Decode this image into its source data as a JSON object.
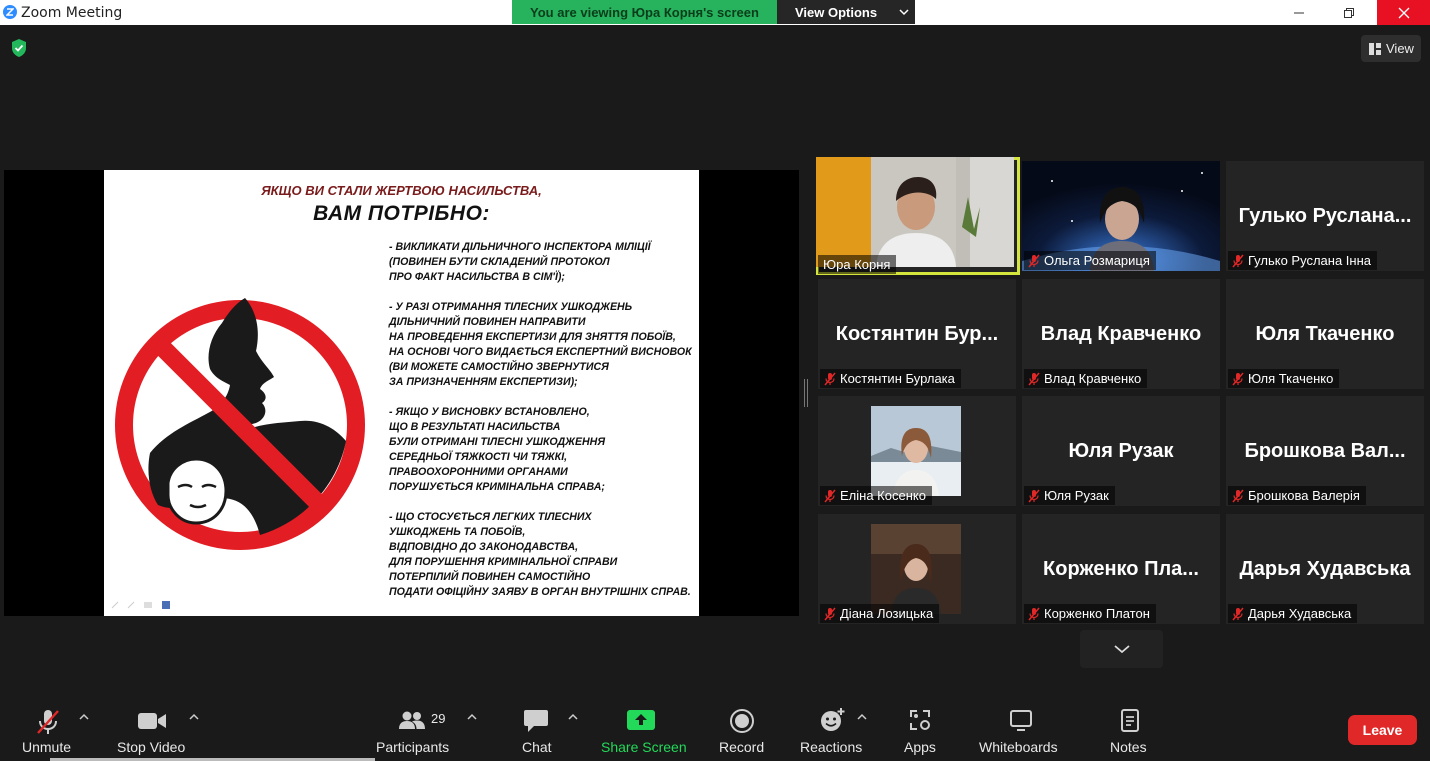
{
  "window": {
    "title": "Zoom Meeting"
  },
  "banner": {
    "viewing_text": "You are viewing Юра Корня's screen",
    "view_options": "View Options"
  },
  "top_right": {
    "view_label": "View"
  },
  "slide": {
    "title_line1": "ЯКЩО ВИ СТАЛИ ЖЕРТВОЮ НАСИЛЬСТВА,",
    "title_line2": "ВАМ ПОТРІБНО:",
    "paragraphs": [
      [
        "- ВИКЛИКАТИ ДІЛЬНИЧНОГО ІНСПЕКТОРА МІЛІЦІЇ",
        "(ПОВИНЕН БУТИ СКЛАДЕНИЙ ПРОТОКОЛ",
        "ПРО ФАКТ НАСИЛЬСТВА В СІМ'Ї);"
      ],
      [
        "- У РАЗІ ОТРИМАННЯ ТІЛЕСНИХ УШКОДЖЕНЬ",
        "ДІЛЬНИЧНИЙ ПОВИНЕН НАПРАВИТИ",
        "НА ПРОВЕДЕННЯ ЕКСПЕРТИЗИ ДЛЯ ЗНЯТТЯ ПОБОЇВ,",
        "НА ОСНОВІ ЧОГО ВИДАЄТЬСЯ ЕКСПЕРТНИЙ ВИСНОВОК",
        "(ВИ МОЖЕТЕ САМОСТІЙНО ЗВЕРНУТИСЯ",
        "ЗА ПРИЗНАЧЕННЯМ ЕКСПЕРТИЗИ);"
      ],
      [
        "- ЯКЩО У ВИСНОВКУ ВСТАНОВЛЕНО,",
        "ЩО В РЕЗУЛЬТАТІ НАСИЛЬСТВА",
        "БУЛИ ОТРИМАНІ ТІЛЕСНІ УШКОДЖЕННЯ",
        "СЕРЕДНЬОЇ ТЯЖКОСТІ ЧИ ТЯЖКІ,",
        "ПРАВООХОРОННИМИ ОРГАНАМИ",
        "ПОРУШУЄТЬСЯ КРИМІНАЛЬНА СПРАВА;"
      ],
      [
        "- ЩО СТОСУЄТЬСЯ ЛЕГКИХ ТІЛЕСНИХ",
        "УШКОДЖЕНЬ ТА ПОБОЇВ,",
        "ВІДПОВІДНО ДО ЗАКОНОДАВСТВА,",
        "ДЛЯ ПОРУШЕННЯ КРИМІНАЛЬНОЇ СПРАВИ",
        "ПОТЕРПІЛИЙ ПОВИНЕН САМОСТІЙНО",
        "ПОДАТИ ОФІЦІЙНУ ЗАЯВУ В ОРГАН ВНУТРІШНІХ СПРАВ."
      ]
    ]
  },
  "participants": [
    {
      "display": "",
      "label": "Юра Корня",
      "muted": false,
      "video": "person-warm",
      "active": true
    },
    {
      "display": "",
      "label": "Ольга Розмариця",
      "muted": true,
      "video": "person-space",
      "active": false
    },
    {
      "display": "Гулько Руслана...",
      "label": "Гулько Руслана Інна",
      "muted": true,
      "video": "",
      "active": false
    },
    {
      "display": "Костянтин Бур...",
      "label": "Костянтин Бурлака",
      "muted": true,
      "video": "",
      "active": false
    },
    {
      "display": "Влад Кравченко",
      "label": "Влад Кравченко",
      "muted": true,
      "video": "",
      "active": false
    },
    {
      "display": "Юля Ткаченко",
      "label": "Юля Ткаченко",
      "muted": true,
      "video": "",
      "active": false
    },
    {
      "display": "",
      "label": "Еліна Косенко",
      "muted": true,
      "video": "person-snow",
      "active": false
    },
    {
      "display": "Юля Рузак",
      "label": "Юля Рузак",
      "muted": true,
      "video": "",
      "active": false
    },
    {
      "display": "Брошкова Вал...",
      "label": "Брошкова Валерія",
      "muted": true,
      "video": "",
      "active": false
    },
    {
      "display": "",
      "label": "Діана Лозицька",
      "muted": true,
      "video": "person-dark",
      "active": false
    },
    {
      "display": "Корженко Пла...",
      "label": "Корженко Платон",
      "muted": true,
      "video": "",
      "active": false
    },
    {
      "display": "Дарья Худавська",
      "label": "Дарья Худавська",
      "muted": true,
      "video": "",
      "active": false
    }
  ],
  "toolbar": {
    "unmute": "Unmute",
    "stop_video": "Stop Video",
    "participants": "Participants",
    "participants_count": "29",
    "chat": "Chat",
    "share_screen": "Share Screen",
    "record": "Record",
    "reactions": "Reactions",
    "apps": "Apps",
    "whiteboards": "Whiteboards",
    "notes": "Notes",
    "leave": "Leave"
  },
  "colors": {
    "share_green": "#23d959",
    "leave_red": "#e02828",
    "banner_green": "#27b35d",
    "active_speaker": "#d4e53d",
    "mute_red": "#e02828"
  }
}
